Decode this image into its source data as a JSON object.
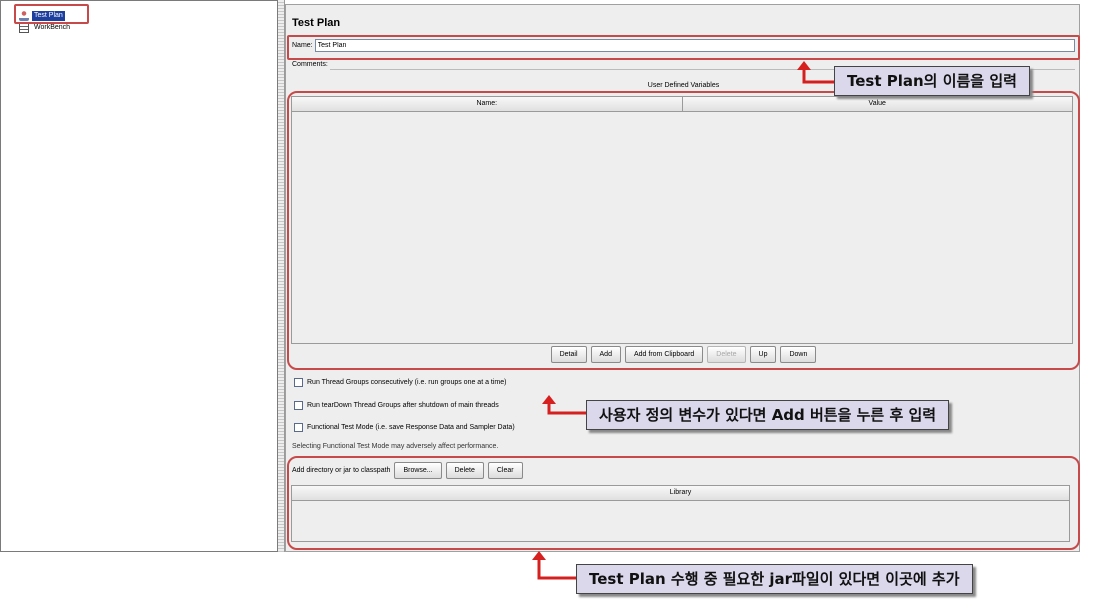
{
  "tree": {
    "items": [
      {
        "label": "Test Plan",
        "icon": "test-plan-icon",
        "selected": true
      },
      {
        "label": "WorkBench",
        "icon": "workbench-icon",
        "selected": false
      }
    ]
  },
  "panel": {
    "title": "Test Plan",
    "name_label": "Name:",
    "name_value": "Test Plan",
    "comments_label": "Comments:",
    "udv": {
      "title": "User Defined Variables",
      "columns": [
        "Name:",
        "Value"
      ],
      "rows": []
    },
    "buttons": [
      "Detail",
      "Add",
      "Add from Clipboard",
      "Delete",
      "Up",
      "Down"
    ],
    "checkboxes": [
      {
        "label": "Run Thread Groups consecutively (i.e. run groups one at a time)",
        "checked": false
      },
      {
        "label": "Run tearDown Thread Groups after shutdown of main threads",
        "checked": false
      },
      {
        "label": "Functional Test Mode (i.e. save Response Data and Sampler Data)",
        "checked": false
      }
    ],
    "warning": "Selecting Functional Test Mode may adversely affect performance.",
    "classpath": {
      "label": "Add directory or jar to classpath",
      "browse": "Browse...",
      "delete": "Delete",
      "clear": "Clear",
      "library_header": "Library"
    }
  },
  "annotations": {
    "name_hint": "Test Plan의 이름을 입력",
    "add_hint": "사용자 정의 변수가 있다면 Add 버튼을 누른 후 입력",
    "jar_hint": "Test Plan 수행 중 필요한 jar파일이 있다면 이곳에 추가",
    "highlight_color": "#c74a4a",
    "callout_color": "#dcd8ec"
  }
}
